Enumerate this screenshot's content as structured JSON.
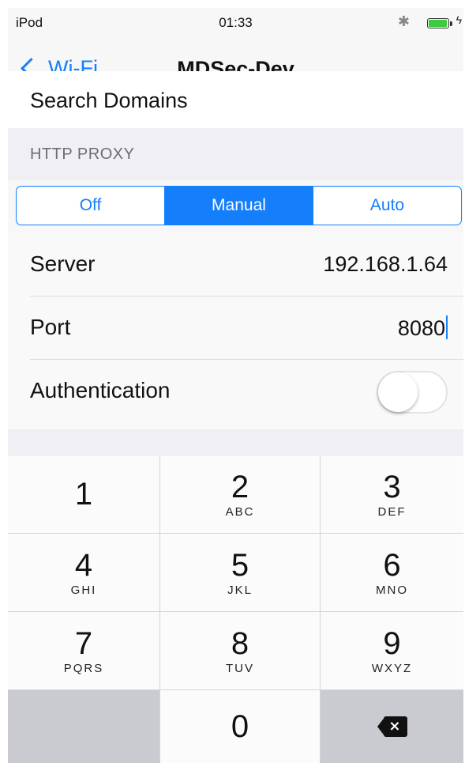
{
  "status_bar": {
    "carrier": "iPod",
    "time": "01:33",
    "bluetooth_icon": "bluetooth-icon",
    "battery_icon": "battery-charging-icon"
  },
  "nav": {
    "back_label": "Wi-Fi",
    "title": "MDSec-Dev"
  },
  "cut_row": {
    "label": "Search Domains"
  },
  "http_proxy": {
    "header": "HTTP PROXY",
    "segments": [
      "Off",
      "Manual",
      "Auto"
    ],
    "selected": "Manual"
  },
  "fields": {
    "server": {
      "label": "Server",
      "value": "192.168.1.64"
    },
    "port": {
      "label": "Port",
      "value": "8080"
    },
    "authentication": {
      "label": "Authentication",
      "enabled": false
    }
  },
  "keypad": {
    "keys": [
      {
        "num": "1",
        "letters": ""
      },
      {
        "num": "2",
        "letters": "ABC"
      },
      {
        "num": "3",
        "letters": "DEF"
      },
      {
        "num": "4",
        "letters": "GHI"
      },
      {
        "num": "5",
        "letters": "JKL"
      },
      {
        "num": "6",
        "letters": "MNO"
      },
      {
        "num": "7",
        "letters": "PQRS"
      },
      {
        "num": "8",
        "letters": "TUV"
      },
      {
        "num": "9",
        "letters": "WXYZ"
      },
      {
        "num": "0",
        "letters": ""
      }
    ],
    "delete_icon": "backspace-icon"
  },
  "colors": {
    "accent": "#157efb",
    "keypad_bg": "#d3d5d9",
    "section_bg": "#efeff4"
  }
}
